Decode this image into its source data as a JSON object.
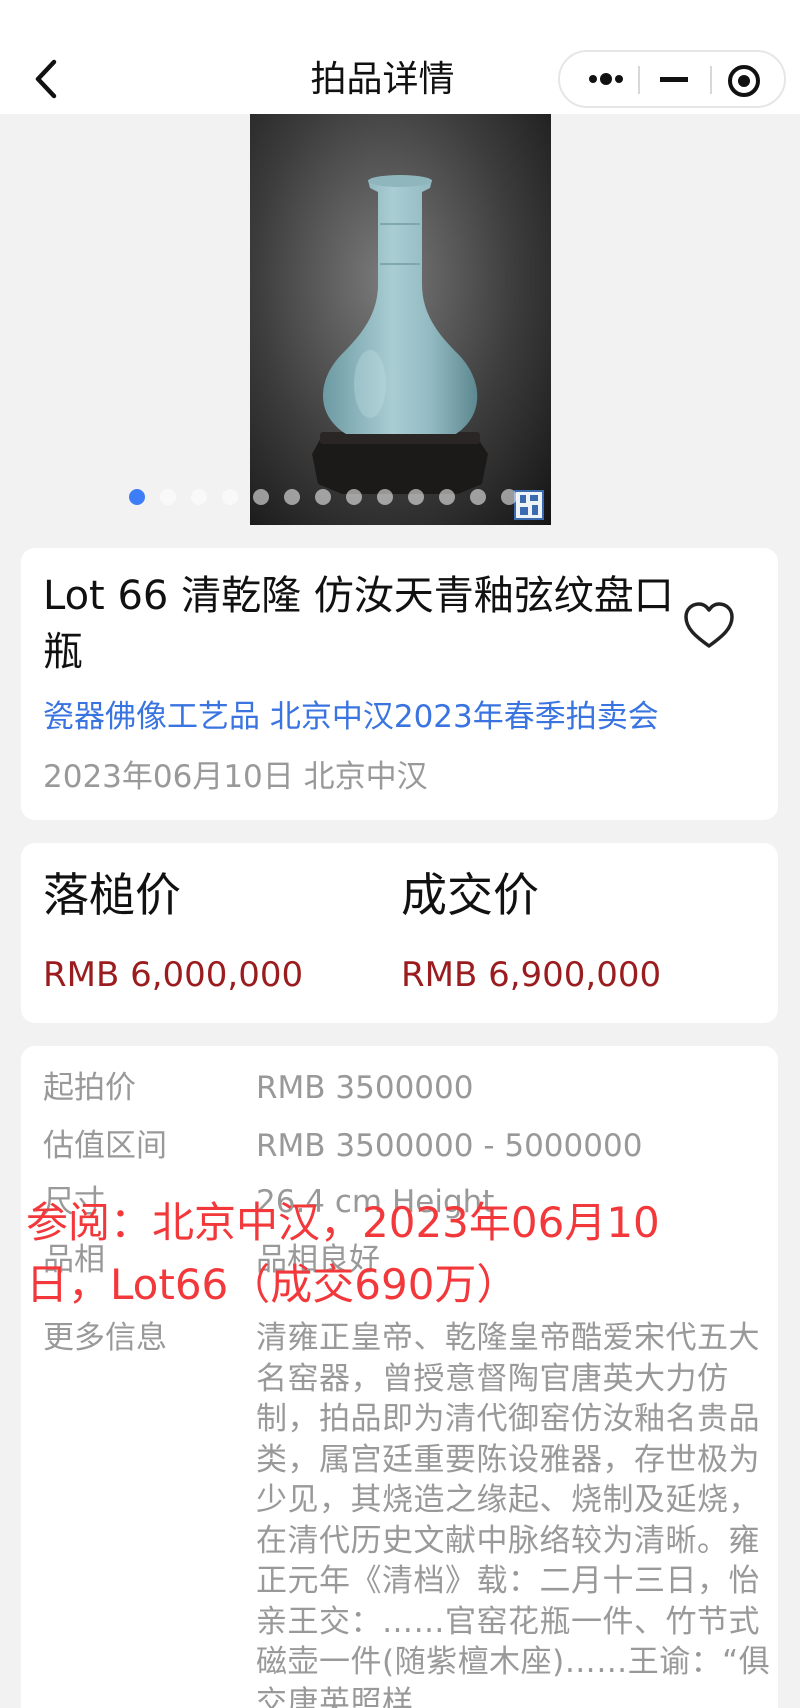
{
  "nav": {
    "title": "拍品详情"
  },
  "gallery": {
    "dot_count": 13,
    "active_index": 0
  },
  "lot": {
    "title": "Lot 66 清乾隆 仿汝天青釉弦纹盘口瓶",
    "sale_link": "瓷器佛像工艺品 北京中汉2023年春季拍卖会",
    "date_house": "2023年06月10日 北京中汉"
  },
  "prices": {
    "hammer_label": "落槌价",
    "hammer_value": "RMB 6,000,000",
    "sold_label": "成交价",
    "sold_value": "RMB 6,900,000"
  },
  "details": {
    "start_label": "起拍价",
    "start_value": "RMB 3500000",
    "estimate_label": "估值区间",
    "estimate_value": "RMB 3500000 - 5000000",
    "size_label": "尺寸",
    "size_value": "26.4 cm Height",
    "condition_label": "品相",
    "condition_value": "品相良好",
    "more_label": "更多信息",
    "more_value": "清雍正皇帝、乾隆皇帝酷爱宋代五大名窑器，曾授意督陶官唐英大力仿制，拍品即为清代御窑仿汝釉名贵品类，属宫廷重要陈设雅器，存世极为少见，其烧造之缘起、烧制及延烧，在清代历史文献中脉络较为清晰。雍正元年《清档》载：二月十三日，怡亲王交：……官窑花瓶一件、竹节式磁壶一件(随紫檀木座)……王谕：“俱交唐英照样"
  },
  "overlay": {
    "text": "参阅：北京中汉，2023年06月10日，Lot66（成交690万）"
  },
  "colors": {
    "accent_blue": "#3a74e0",
    "price_red": "#9b1c1f",
    "overlay_red": "#f2383a",
    "active_dot": "#3d7ef7"
  },
  "icons": {
    "back": "chevron-left-icon",
    "more": "more-dots-icon",
    "minimize": "minus-icon",
    "close": "target-circle-icon",
    "favorite": "heart-outline-icon"
  }
}
